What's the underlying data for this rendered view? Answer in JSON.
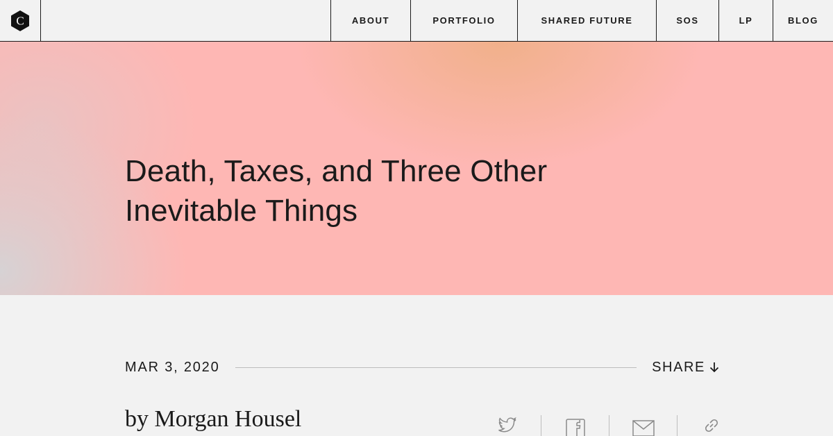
{
  "nav": {
    "logo_letter": "C",
    "items": [
      {
        "label": "ABOUT"
      },
      {
        "label": "PORTFOLIO"
      },
      {
        "label": "SHARED FUTURE"
      },
      {
        "label": "SOS"
      },
      {
        "label": "LP"
      },
      {
        "label": "BLOG"
      }
    ]
  },
  "hero": {
    "title_line1": "Death, Taxes, and Three Other",
    "title_line2": "Inevitable Things",
    "colors": {
      "base": "#feb7b4",
      "warm": "#f0b088",
      "cool": "#d6d2d4"
    }
  },
  "post": {
    "date": "MAR 3, 2020",
    "share_label": "SHARE",
    "author": "by Morgan Housel"
  },
  "social": {
    "icons": [
      "twitter-icon",
      "facebook-icon",
      "email-icon",
      "link-icon"
    ]
  }
}
